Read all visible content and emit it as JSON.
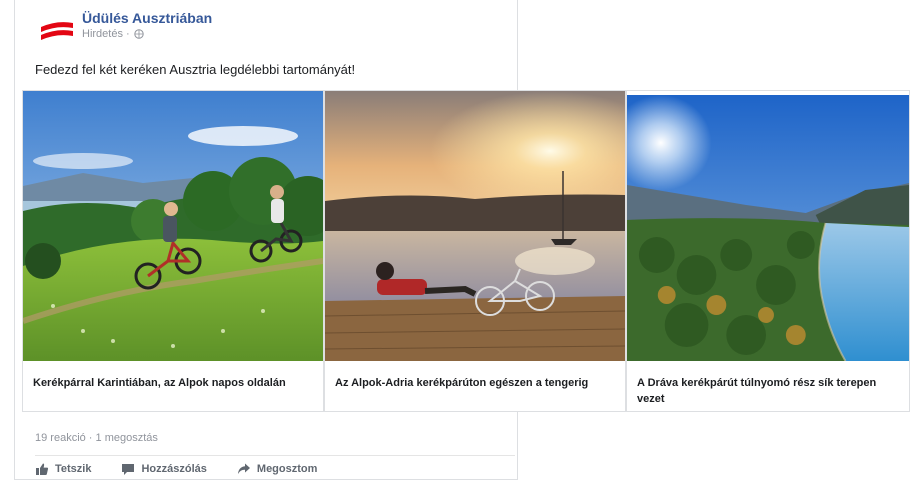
{
  "post": {
    "page_name": "Üdülés Ausztriában",
    "meta": "Hirdetés ·",
    "text": "Fedezd fel két keréken Ausztria legdélebbi tartományát!",
    "brand_colors": {
      "flag_red": "#e30613",
      "link_blue": "#365899"
    }
  },
  "carousel": {
    "cards": [
      {
        "caption": "Kerékpárral Karintiában, az Alpok napos oldalán",
        "image": "cyclists-on-green-hill-with-lake"
      },
      {
        "caption": "Az Alpok-Adria kerékpárúton egészen a tengerig",
        "image": "man-resting-on-pier-at-sunset-with-bicycle"
      },
      {
        "caption": "A Dráva kerékpárút túlnyomó rész sík terepen vezet",
        "image": "river-valley-with-forest-and-sun"
      }
    ]
  },
  "stats": {
    "text": "19 reakció · 1 megosztás"
  },
  "actions": {
    "like": {
      "label": "Tetszik",
      "icon": "thumbs-up-icon"
    },
    "comment": {
      "label": "Hozzászólás",
      "icon": "comment-icon"
    },
    "share": {
      "label": "Megosztom",
      "icon": "share-arrow-icon"
    }
  }
}
